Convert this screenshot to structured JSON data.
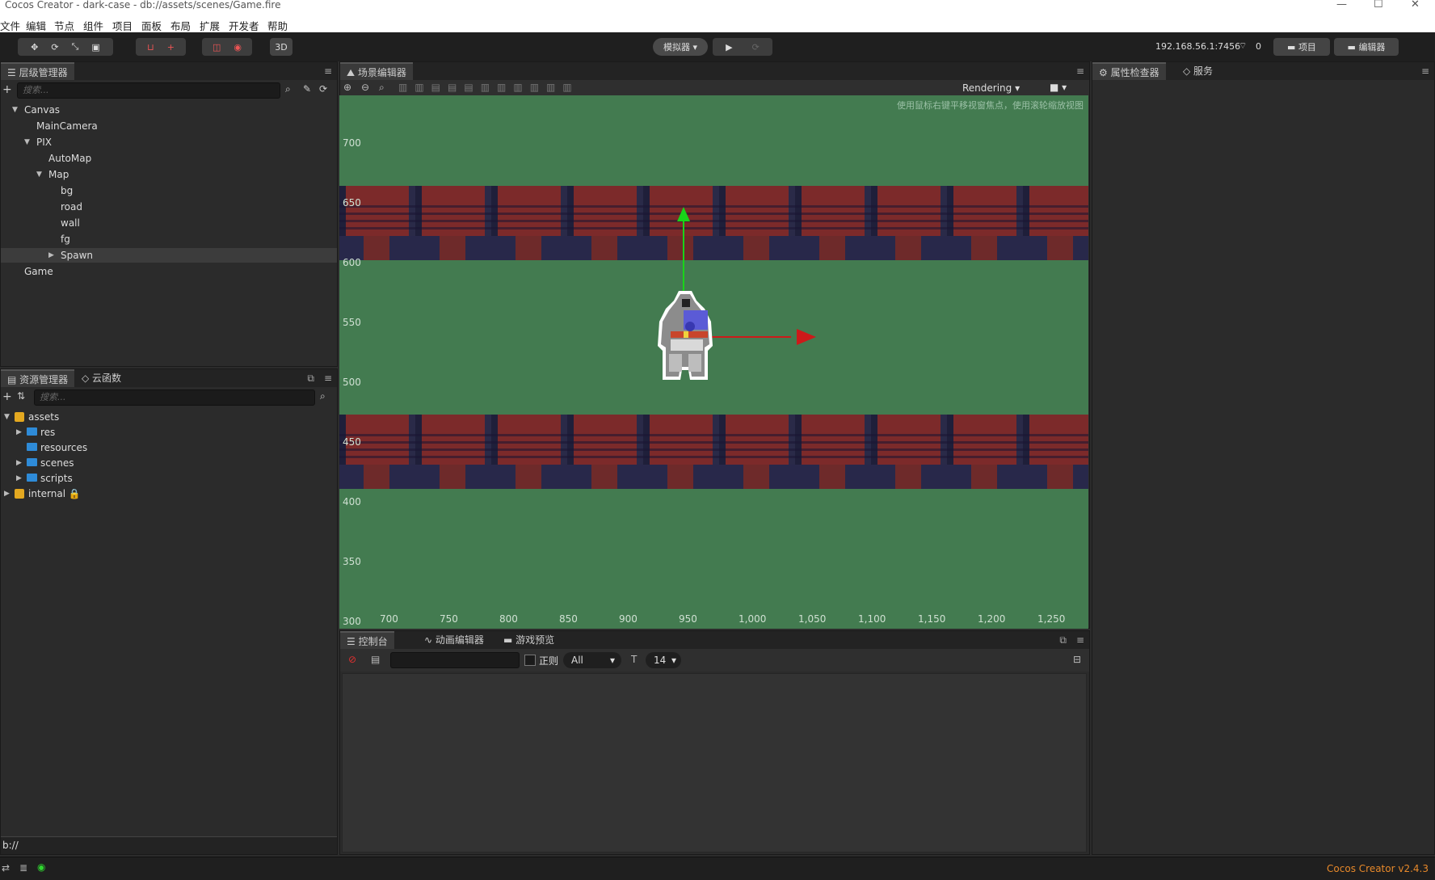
{
  "window": {
    "title": "Cocos Creator - dark-case - db://assets/scenes/Game.fire",
    "controls": [
      "—",
      "☐",
      "✕"
    ]
  },
  "menu": [
    "文件",
    "编辑",
    "节点",
    "组件",
    "项目",
    "面板",
    "布局",
    "扩展",
    "开发者",
    "帮助"
  ],
  "toolbar": {
    "mode_3d": "3D",
    "simulator": "模拟器 ▾",
    "ip": "192.168.56.1:7456",
    "count": "0",
    "project_btn": "项目",
    "editor_btn": "编辑器"
  },
  "hierarchy": {
    "tab": "层级管理器",
    "search_placeholder": "搜索...",
    "nodes": [
      {
        "label": "Canvas",
        "depth": 0,
        "arrow": "▼"
      },
      {
        "label": "MainCamera",
        "depth": 1,
        "arrow": ""
      },
      {
        "label": "PIX",
        "depth": 1,
        "arrow": "▼"
      },
      {
        "label": "AutoMap",
        "depth": 2,
        "arrow": ""
      },
      {
        "label": "Map",
        "depth": 2,
        "arrow": "▼"
      },
      {
        "label": "bg",
        "depth": 3,
        "arrow": ""
      },
      {
        "label": "road",
        "depth": 3,
        "arrow": ""
      },
      {
        "label": "wall",
        "depth": 3,
        "arrow": ""
      },
      {
        "label": "fg",
        "depth": 3,
        "arrow": ""
      },
      {
        "label": "Spawn",
        "depth": 3,
        "arrow": "▶"
      },
      {
        "label": "Game",
        "depth": 0,
        "arrow": ""
      }
    ]
  },
  "assets": {
    "tabs": [
      "资源管理器",
      "云函数"
    ],
    "search_placeholder": "搜索...",
    "items": [
      {
        "label": "assets",
        "depth": 0,
        "arrow": "▼",
        "kind": "pkg"
      },
      {
        "label": "res",
        "depth": 1,
        "arrow": "▶",
        "kind": "folder"
      },
      {
        "label": "resources",
        "depth": 1,
        "arrow": "",
        "kind": "folder"
      },
      {
        "label": "scenes",
        "depth": 1,
        "arrow": "▶",
        "kind": "folder"
      },
      {
        "label": "scripts",
        "depth": 1,
        "arrow": "▶",
        "kind": "folder"
      },
      {
        "label": "internal 🔒",
        "depth": 0,
        "arrow": "▶",
        "kind": "pkg"
      }
    ],
    "path": "b://"
  },
  "scene": {
    "tab": "场景编辑器",
    "rendering": "Rendering",
    "hint": "使用鼠标右键平移视窗焦点，使用滚轮缩放视图",
    "y_ticks": [
      "700",
      "650",
      "600",
      "550",
      "500",
      "450",
      "400",
      "350",
      "300"
    ],
    "x_ticks": [
      "700",
      "750",
      "800",
      "850",
      "900",
      "950",
      "1,000",
      "1,050",
      "1,100",
      "1,150",
      "1,200",
      "1,250"
    ]
  },
  "console": {
    "tabs": [
      "控制台",
      "动画编辑器",
      "游戏预览"
    ],
    "regex_label": "正则",
    "filter": "All",
    "font_size": "14"
  },
  "inspector": {
    "tabs": [
      "属性检查器",
      "服务"
    ]
  },
  "status": {
    "version": "Cocos Creator v2.4.3"
  }
}
